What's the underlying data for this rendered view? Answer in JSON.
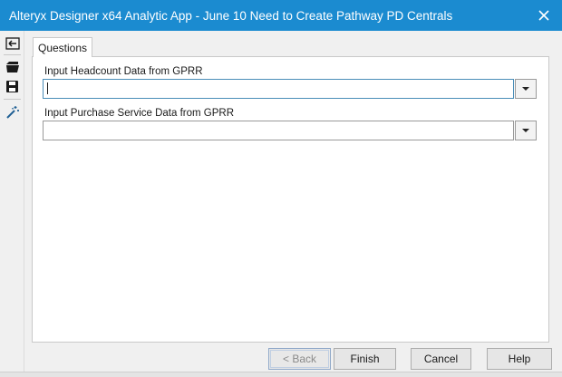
{
  "window": {
    "title": "Alteryx Designer x64 Analytic App - June 10 Need to Create Pathway PD Centrals",
    "close_icon": "close-icon"
  },
  "toolbar": {
    "items": [
      {
        "icon": "back-arrow-icon"
      },
      {
        "icon": "open-folder-icon"
      },
      {
        "icon": "save-icon"
      },
      {
        "icon": "magic-wand-icon"
      }
    ]
  },
  "tabs": [
    {
      "label": "Questions",
      "active": true
    }
  ],
  "questions": [
    {
      "label": "Input Headcount Data from GPRR",
      "value": "",
      "placeholder": ""
    },
    {
      "label": "Input Purchase Service Data from GPRR",
      "value": "",
      "placeholder": ""
    }
  ],
  "buttons": {
    "back": "< Back",
    "finish": "Finish",
    "cancel": "Cancel",
    "help": "Help"
  },
  "colors": {
    "titlebar": "#1b8bd0",
    "icon_blue": "#1f5f94"
  }
}
